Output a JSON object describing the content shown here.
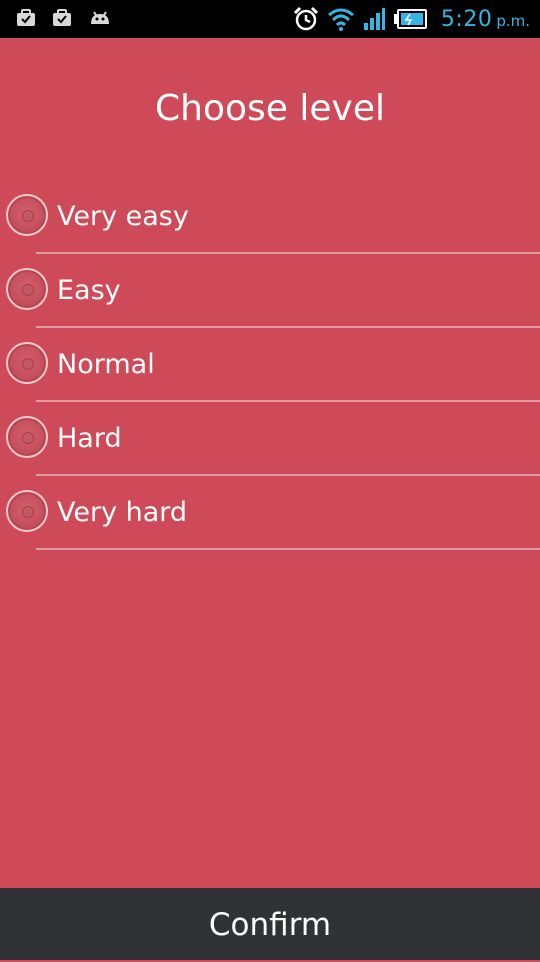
{
  "status_bar": {
    "left_icons": [
      "briefcase-check-icon",
      "briefcase-check-icon",
      "android-icon"
    ],
    "right_icons": [
      "alarm-icon",
      "wifi-icon",
      "signal-icon",
      "battery-charging-icon"
    ],
    "time": "5:20",
    "ampm": "p.m.",
    "time_color": "#33b5e5"
  },
  "screen": {
    "title": "Choose level",
    "background_color": "#cf4a59"
  },
  "levels": {
    "options": [
      {
        "label": "Very easy",
        "selected": false
      },
      {
        "label": "Easy",
        "selected": false
      },
      {
        "label": "Normal",
        "selected": false
      },
      {
        "label": "Hard",
        "selected": false
      },
      {
        "label": "Very hard",
        "selected": false
      }
    ]
  },
  "footer": {
    "confirm_label": "Confirm",
    "background_color": "#313236"
  }
}
